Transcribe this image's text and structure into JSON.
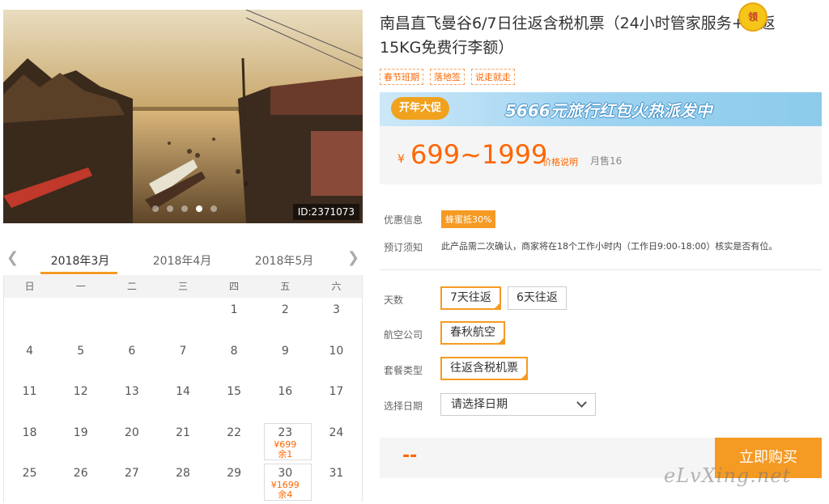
{
  "hero": {
    "image_id": "ID:2371073",
    "dots": [
      false,
      false,
      false,
      true,
      false
    ]
  },
  "calendar": {
    "months": [
      "2018年3月",
      "2018年4月",
      "2018年5月"
    ],
    "weekdays": [
      "日",
      "一",
      "二",
      "三",
      "四",
      "五",
      "六"
    ],
    "rows": [
      [
        {
          "d": ""
        },
        {
          "d": ""
        },
        {
          "d": ""
        },
        {
          "d": ""
        },
        {
          "d": "1"
        },
        {
          "d": "2"
        },
        {
          "d": "3"
        }
      ],
      [
        {
          "d": "4"
        },
        {
          "d": "5"
        },
        {
          "d": "6"
        },
        {
          "d": "7"
        },
        {
          "d": "8"
        },
        {
          "d": "9"
        },
        {
          "d": "10"
        }
      ],
      [
        {
          "d": "11"
        },
        {
          "d": "12"
        },
        {
          "d": "13"
        },
        {
          "d": "14"
        },
        {
          "d": "15"
        },
        {
          "d": "16"
        },
        {
          "d": "17"
        }
      ],
      [
        {
          "d": "18"
        },
        {
          "d": "19"
        },
        {
          "d": "20"
        },
        {
          "d": "21"
        },
        {
          "d": "22"
        },
        {
          "d": "23",
          "price": "¥699",
          "stock": "余1"
        },
        {
          "d": "24"
        }
      ],
      [
        {
          "d": "25"
        },
        {
          "d": "26"
        },
        {
          "d": "27"
        },
        {
          "d": "28"
        },
        {
          "d": "29"
        },
        {
          "d": "30",
          "price": "¥1699",
          "stock": "余4"
        },
        {
          "d": "31"
        }
      ]
    ]
  },
  "product": {
    "title": "南昌直飞曼谷6/7日往返含税机票（24小时管家服务+往返15KG免费行李额）",
    "tags": [
      "春节班期",
      "落地签",
      "说走就走"
    ]
  },
  "banner": {
    "badge": "开年大促",
    "text": "5666元旅行红包火热派发中",
    "coin": "领"
  },
  "price": {
    "currency": "¥",
    "range": "699~1999",
    "note": "价格说明",
    "sold_label": "月售",
    "sold_count": "16"
  },
  "info": {
    "promo_label": "优惠信息",
    "promo_badge": "蜂蜜抵30%",
    "notice_label": "预订须知",
    "notice_text": "此产品需二次确认，商家将在18个工作小时内（工作日9:00-18:00）核实是否有位。"
  },
  "options": {
    "days_label": "天数",
    "days": [
      "7天往返",
      "6天往返"
    ],
    "airline_label": "航空公司",
    "airline": "春秋航空",
    "package_label": "套餐类型",
    "package": "往返含税机票",
    "date_label": "选择日期",
    "date_placeholder": "请选择日期"
  },
  "purchase": {
    "total": "--",
    "button": "立即购买"
  },
  "watermark": "eLvXing.net",
  "colors": {
    "accent": "#f59a23",
    "price": "#ff6600"
  }
}
